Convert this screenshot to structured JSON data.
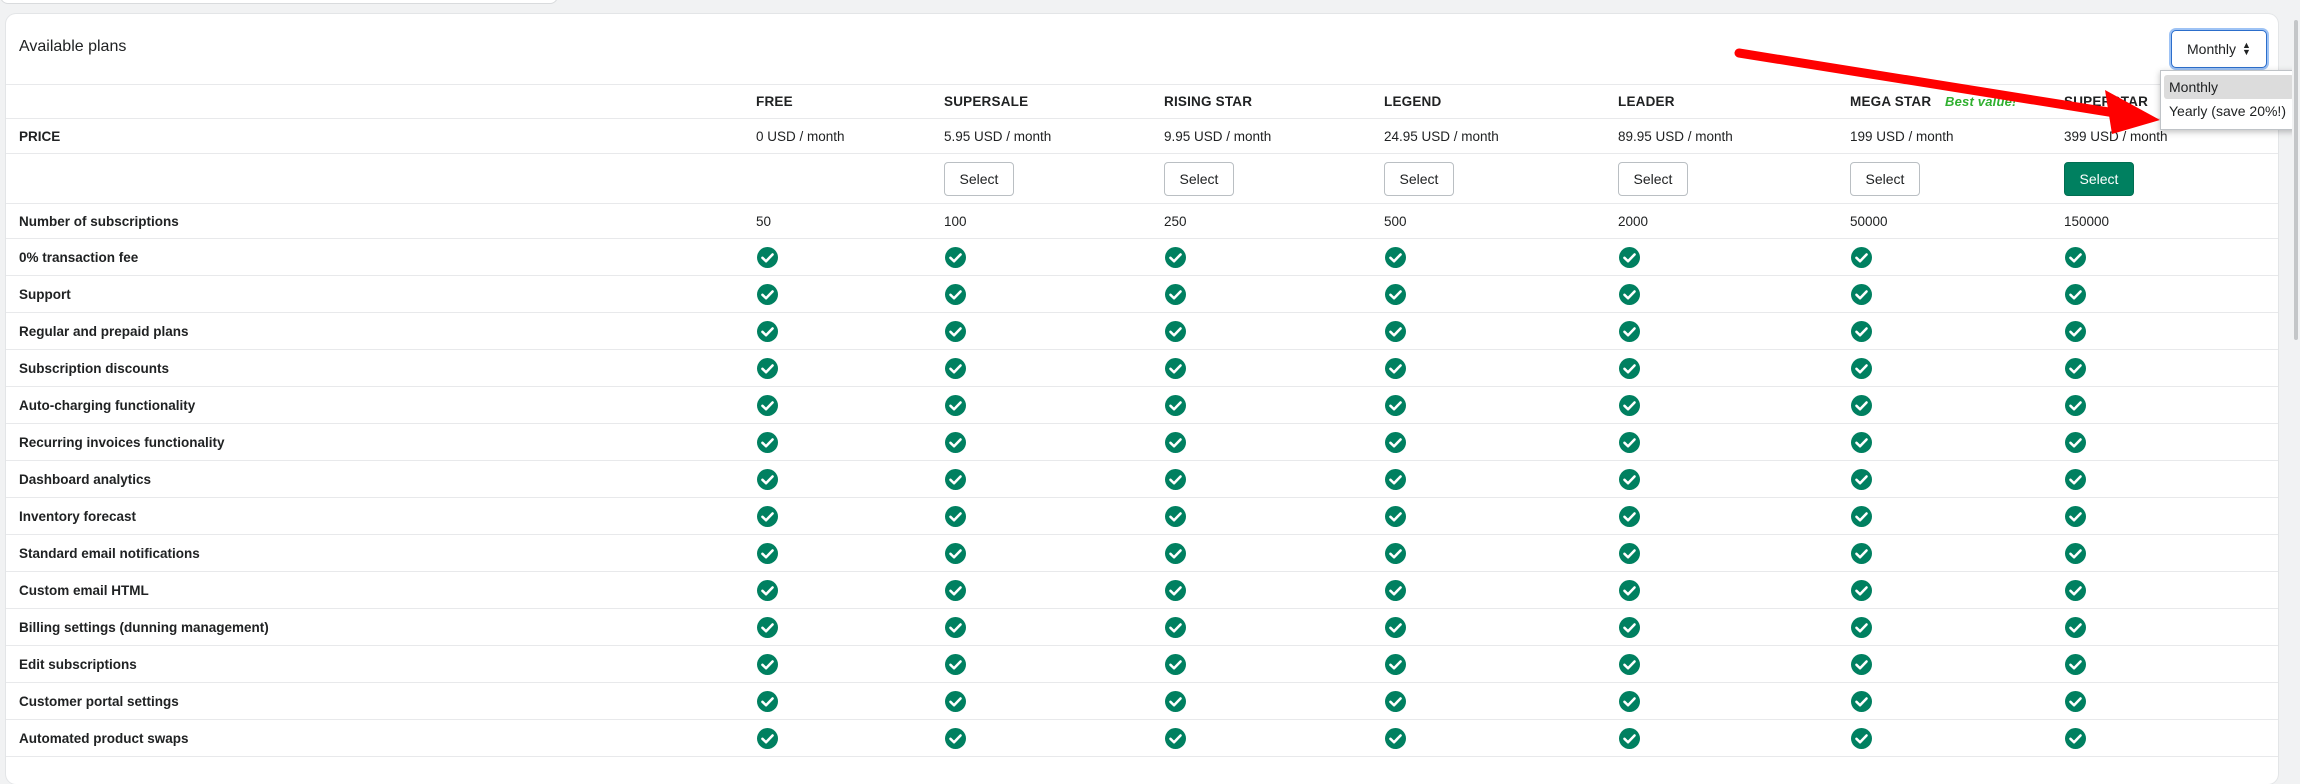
{
  "card": {
    "title": "Available plans"
  },
  "period_select": {
    "value": "Monthly",
    "options": [
      "Monthly",
      "Yearly (save 20%!)"
    ]
  },
  "plans": [
    {
      "name": "FREE",
      "price": "0 USD / month",
      "subscriptions": "50",
      "select_label": ""
    },
    {
      "name": "SUPERSALE",
      "price": "5.95 USD / month",
      "subscriptions": "100",
      "select_label": "Select"
    },
    {
      "name": "RISING STAR",
      "price": "9.95 USD / month",
      "subscriptions": "250",
      "select_label": "Select"
    },
    {
      "name": "LEGEND",
      "price": "24.95 USD / month",
      "subscriptions": "500",
      "select_label": "Select"
    },
    {
      "name": "LEADER",
      "price": "89.95 USD / month",
      "subscriptions": "2000",
      "select_label": "Select"
    },
    {
      "name": "MEGA STAR",
      "price": "199 USD / month",
      "subscriptions": "50000",
      "select_label": "Select",
      "badge": "Best value!"
    },
    {
      "name": "SUPERSTAR",
      "price": "399 USD / month",
      "subscriptions": "150000",
      "select_label": "Select",
      "primary": true
    }
  ],
  "rows": {
    "price_label": "PRICE",
    "subscriptions_label": "Number of subscriptions"
  },
  "features": [
    "0% transaction fee",
    "Support",
    "Regular and prepaid plans",
    "Subscription discounts",
    "Auto-charging functionality",
    "Recurring invoices functionality",
    "Dashboard analytics",
    "Inventory forecast",
    "Standard email notifications",
    "Custom email HTML",
    "Billing settings (dunning management)",
    "Edit subscriptions",
    "Customer portal settings",
    "Automated product swaps"
  ],
  "icons": {
    "included": "check-circle-icon",
    "select_caret": "up-down-caret-icon",
    "annotation": "red-arrow"
  },
  "colors": {
    "primary": "#008060",
    "check": "#008060",
    "badge": "#2fb02f",
    "annotation_arrow": "#ff0000",
    "focus": "#2c6ecb"
  }
}
